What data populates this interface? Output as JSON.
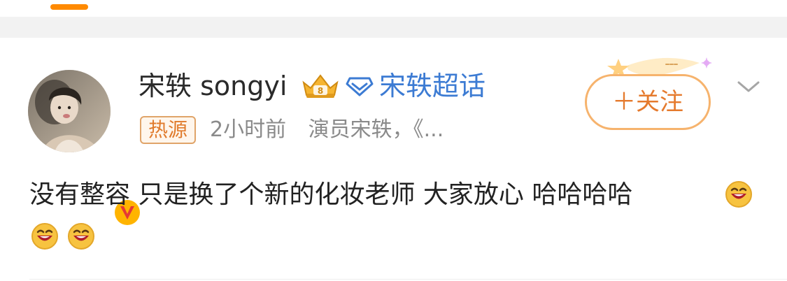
{
  "user": {
    "name": "宋轶 songyi",
    "super_topic_label": "宋轶超话"
  },
  "meta": {
    "source_badge": "热源",
    "time": "2小时前",
    "description": "演员宋轶，《..."
  },
  "actions": {
    "follow_label": "＋关注"
  },
  "post": {
    "text": "没有整容 只是换了个新的化妆老师 大家放心 哈哈哈哈"
  },
  "icons": {
    "verified": "verified-v-badge",
    "crown": "crown-level-icon",
    "diamond": "super-topic-diamond-icon",
    "dropdown": "chevron-down-icon",
    "emoji": "laughing-emoji"
  },
  "colors": {
    "accent": "#FF8A00",
    "super_topic_blue": "#3C7BD3",
    "follow_orange": "#E57A2D",
    "text_primary": "#222222",
    "text_secondary": "#8A8A8A"
  }
}
